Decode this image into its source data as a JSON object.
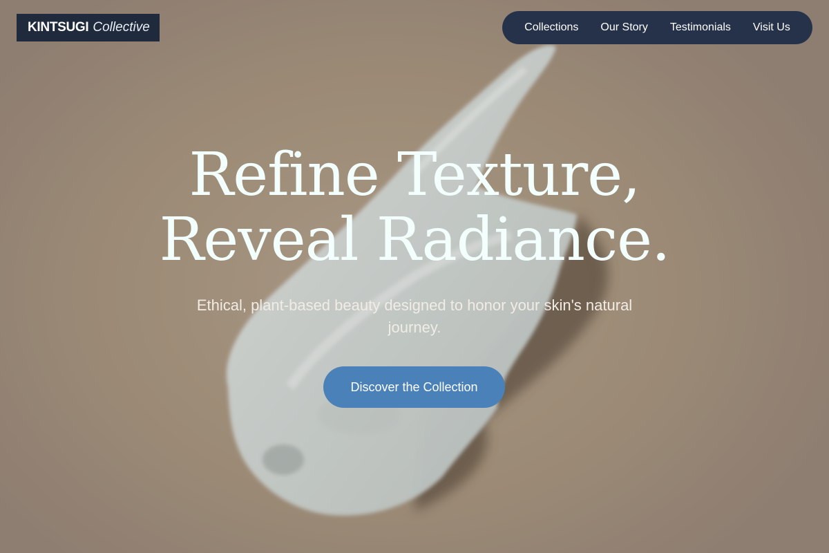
{
  "brand": {
    "name_bold": "KINTSUGI",
    "name_light": "Collective"
  },
  "nav": {
    "items": [
      {
        "label": "Collections"
      },
      {
        "label": "Our Story"
      },
      {
        "label": "Testimonials"
      },
      {
        "label": "Visit Us"
      }
    ]
  },
  "hero": {
    "headline_line1": "Refine Texture,",
    "headline_line2": "Reveal Radiance.",
    "subtitle": "Ethical, plant-based beauty designed to honor your skin's natural journey.",
    "cta_label": "Discover the Collection",
    "background_image": "cream-smear-photo"
  },
  "colors": {
    "logo_bg": "#1f2a3d",
    "nav_bg": "#26324a",
    "cta_bg": "#4a81b8",
    "headline": "#f3fffd",
    "page_bg": "#a3917f"
  }
}
